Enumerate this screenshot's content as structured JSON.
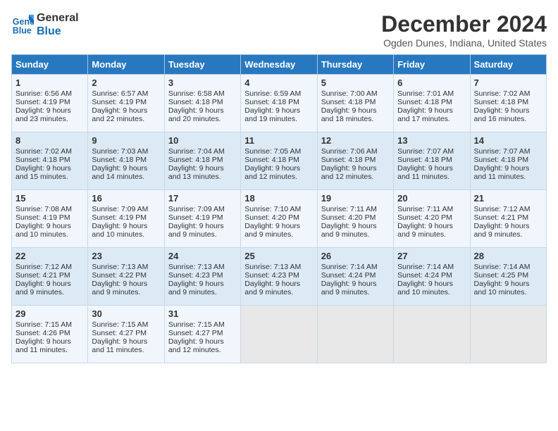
{
  "header": {
    "logo_line1": "General",
    "logo_line2": "Blue",
    "month_title": "December 2024",
    "subtitle": "Ogden Dunes, Indiana, United States"
  },
  "days_of_week": [
    "Sunday",
    "Monday",
    "Tuesday",
    "Wednesday",
    "Thursday",
    "Friday",
    "Saturday"
  ],
  "weeks": [
    [
      {
        "day": "1",
        "rise": "6:56 AM",
        "set": "4:19 PM",
        "daylight": "9 hours and 23 minutes."
      },
      {
        "day": "2",
        "rise": "6:57 AM",
        "set": "4:19 PM",
        "daylight": "9 hours and 22 minutes."
      },
      {
        "day": "3",
        "rise": "6:58 AM",
        "set": "4:18 PM",
        "daylight": "9 hours and 20 minutes."
      },
      {
        "day": "4",
        "rise": "6:59 AM",
        "set": "4:18 PM",
        "daylight": "9 hours and 19 minutes."
      },
      {
        "day": "5",
        "rise": "7:00 AM",
        "set": "4:18 PM",
        "daylight": "9 hours and 18 minutes."
      },
      {
        "day": "6",
        "rise": "7:01 AM",
        "set": "4:18 PM",
        "daylight": "9 hours and 17 minutes."
      },
      {
        "day": "7",
        "rise": "7:02 AM",
        "set": "4:18 PM",
        "daylight": "9 hours and 16 minutes."
      }
    ],
    [
      {
        "day": "8",
        "rise": "7:02 AM",
        "set": "4:18 PM",
        "daylight": "9 hours and 15 minutes."
      },
      {
        "day": "9",
        "rise": "7:03 AM",
        "set": "4:18 PM",
        "daylight": "9 hours and 14 minutes."
      },
      {
        "day": "10",
        "rise": "7:04 AM",
        "set": "4:18 PM",
        "daylight": "9 hours and 13 minutes."
      },
      {
        "day": "11",
        "rise": "7:05 AM",
        "set": "4:18 PM",
        "daylight": "9 hours and 12 minutes."
      },
      {
        "day": "12",
        "rise": "7:06 AM",
        "set": "4:18 PM",
        "daylight": "9 hours and 12 minutes."
      },
      {
        "day": "13",
        "rise": "7:07 AM",
        "set": "4:18 PM",
        "daylight": "9 hours and 11 minutes."
      },
      {
        "day": "14",
        "rise": "7:07 AM",
        "set": "4:18 PM",
        "daylight": "9 hours and 11 minutes."
      }
    ],
    [
      {
        "day": "15",
        "rise": "7:08 AM",
        "set": "4:19 PM",
        "daylight": "9 hours and 10 minutes."
      },
      {
        "day": "16",
        "rise": "7:09 AM",
        "set": "4:19 PM",
        "daylight": "9 hours and 10 minutes."
      },
      {
        "day": "17",
        "rise": "7:09 AM",
        "set": "4:19 PM",
        "daylight": "9 hours and 9 minutes."
      },
      {
        "day": "18",
        "rise": "7:10 AM",
        "set": "4:20 PM",
        "daylight": "9 hours and 9 minutes."
      },
      {
        "day": "19",
        "rise": "7:11 AM",
        "set": "4:20 PM",
        "daylight": "9 hours and 9 minutes."
      },
      {
        "day": "20",
        "rise": "7:11 AM",
        "set": "4:20 PM",
        "daylight": "9 hours and 9 minutes."
      },
      {
        "day": "21",
        "rise": "7:12 AM",
        "set": "4:21 PM",
        "daylight": "9 hours and 9 minutes."
      }
    ],
    [
      {
        "day": "22",
        "rise": "7:12 AM",
        "set": "4:21 PM",
        "daylight": "9 hours and 9 minutes."
      },
      {
        "day": "23",
        "rise": "7:13 AM",
        "set": "4:22 PM",
        "daylight": "9 hours and 9 minutes."
      },
      {
        "day": "24",
        "rise": "7:13 AM",
        "set": "4:23 PM",
        "daylight": "9 hours and 9 minutes."
      },
      {
        "day": "25",
        "rise": "7:13 AM",
        "set": "4:23 PM",
        "daylight": "9 hours and 9 minutes."
      },
      {
        "day": "26",
        "rise": "7:14 AM",
        "set": "4:24 PM",
        "daylight": "9 hours and 9 minutes."
      },
      {
        "day": "27",
        "rise": "7:14 AM",
        "set": "4:24 PM",
        "daylight": "9 hours and 10 minutes."
      },
      {
        "day": "28",
        "rise": "7:14 AM",
        "set": "4:25 PM",
        "daylight": "9 hours and 10 minutes."
      }
    ],
    [
      {
        "day": "29",
        "rise": "7:15 AM",
        "set": "4:26 PM",
        "daylight": "9 hours and 11 minutes."
      },
      {
        "day": "30",
        "rise": "7:15 AM",
        "set": "4:27 PM",
        "daylight": "9 hours and 11 minutes."
      },
      {
        "day": "31",
        "rise": "7:15 AM",
        "set": "4:27 PM",
        "daylight": "9 hours and 12 minutes."
      },
      null,
      null,
      null,
      null
    ]
  ],
  "labels": {
    "sunrise": "Sunrise:",
    "sunset": "Sunset:",
    "daylight": "Daylight:"
  }
}
